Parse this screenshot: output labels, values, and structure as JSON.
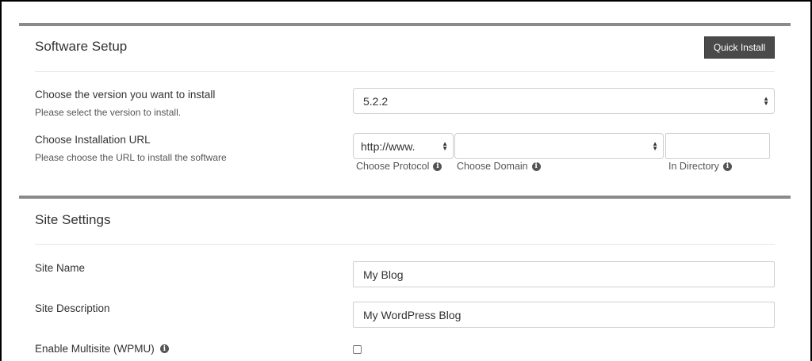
{
  "software_setup": {
    "title": "Software Setup",
    "quick_install_label": "Quick Install",
    "version": {
      "label": "Choose the version you want to install",
      "help": "Please select the version to install.",
      "value": "5.2.2"
    },
    "installation_url": {
      "label": "Choose Installation URL",
      "help": "Please choose the URL to install the software",
      "protocol_value": "http://www.",
      "domain_value": "",
      "directory_value": "",
      "protocol_hint": "Choose Protocol",
      "domain_hint": "Choose Domain",
      "directory_hint": "In Directory"
    }
  },
  "site_settings": {
    "title": "Site Settings",
    "site_name": {
      "label": "Site Name",
      "value": "My Blog"
    },
    "site_description": {
      "label": "Site Description",
      "value": "My WordPress Blog"
    },
    "multisite": {
      "label": "Enable Multisite (WPMU)",
      "checked": false
    }
  }
}
